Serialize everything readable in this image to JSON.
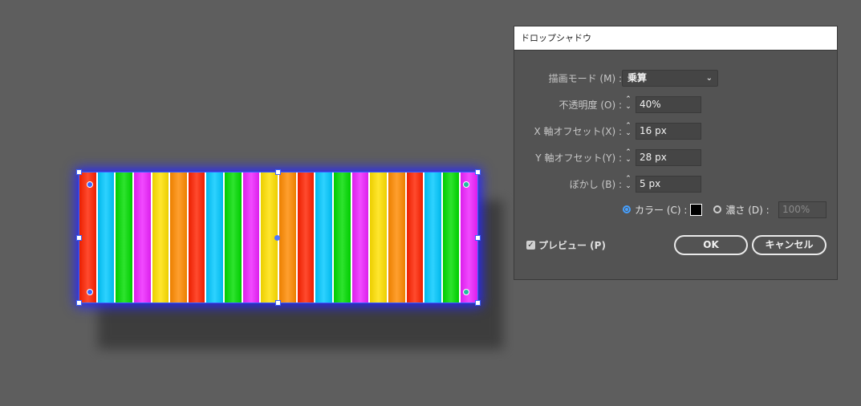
{
  "canvas": {
    "stripe_colors": [
      "#ff2200",
      "#00c8ff",
      "#00dd00",
      "#ee22ff",
      "#ffe000",
      "#ff8a00",
      "#ff2200",
      "#00c8ff",
      "#00dd00",
      "#ee22ff",
      "#ffe000",
      "#ff8a00",
      "#ff2200",
      "#00c8ff",
      "#00dd00",
      "#ee22ff",
      "#ffe000",
      "#ff8a00",
      "#ff2200",
      "#00c8ff",
      "#00dd00",
      "#ee22ff"
    ],
    "glow_color": "#2828ff",
    "selection_color": "#3b63ff"
  },
  "dialog": {
    "title": "ドロップシャドウ",
    "blend_mode": {
      "label": "描画モード (M) :",
      "value": "乗算",
      "icon": "chevron-down-icon"
    },
    "opacity": {
      "label": "不透明度 (O) :",
      "value": "40%"
    },
    "x_offset": {
      "label": "X 軸オフセット(X) :",
      "value": "16 px"
    },
    "y_offset": {
      "label": "Y 軸オフセット(Y) :",
      "value": "28 px"
    },
    "blur": {
      "label": "ぼかし (B) :",
      "value": "5 px"
    },
    "color_option": {
      "label": "カラー (C) :",
      "selected": true,
      "swatch": "#000000"
    },
    "darkness_option": {
      "label": "濃さ (D) :",
      "selected": false,
      "value": "100%"
    },
    "preview": {
      "label": "プレビュー (P)",
      "checked": true
    },
    "ok_label": "OK",
    "cancel_label": "キャンセル"
  }
}
